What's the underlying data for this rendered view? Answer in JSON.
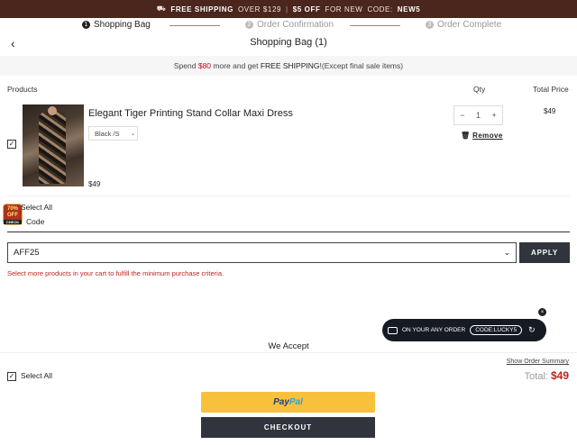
{
  "promo_bar": {
    "free_shipping": "FREE SHIPPING",
    "over": "OVER $129",
    "discount": "$5 OFF",
    "for_new": "FOR NEW",
    "code_label": "CODE:",
    "code": "NEW5"
  },
  "steps": [
    {
      "num": "1",
      "label": "Shopping Bag"
    },
    {
      "num": "2",
      "label": "Order Confirmation"
    },
    {
      "num": "3",
      "label": "Order Complete"
    }
  ],
  "header": {
    "back": "‹",
    "title": "Shopping Bag (1)"
  },
  "shipping_band": {
    "prefix": "Spend ",
    "amount": "$80",
    "middle": " more and get ",
    "free": "FREE SHIPPING",
    "suffix": "!(Except final sale items)"
  },
  "columns": {
    "products": "Products",
    "qty": "Qty",
    "total_price": "Total Price"
  },
  "cart_item": {
    "checked": "✓",
    "name": "Elegant Tiger Printing Stand Collar Maxi Dress",
    "variant": "Black /S",
    "price": "$49",
    "qty": "1",
    "minus": "−",
    "plus": "+",
    "remove": "Remove",
    "total": "$49"
  },
  "badge": {
    "line1": "70%",
    "line2": "OFF",
    "check": "CHECK"
  },
  "select_all_top": "Select All",
  "code_label": "Code",
  "coupon": {
    "value": "AFF25",
    "apply": "APPLY",
    "error": "Select more products in your cart to fulfill the minimum purchase criteria."
  },
  "float_promo": {
    "text": "ON YOUR ANY ORDER",
    "code": "CODE:LUCKY5",
    "close": "×"
  },
  "we_accept": "We Accept",
  "footer": {
    "show_summary": "Show Order Summary",
    "select_all": "Select All",
    "checked": "✓",
    "total_label": "Total:",
    "total_value": "$49",
    "paypal_pay": "Pay",
    "paypal_pal": "Pal",
    "checkout": "CHECKOUT"
  }
}
